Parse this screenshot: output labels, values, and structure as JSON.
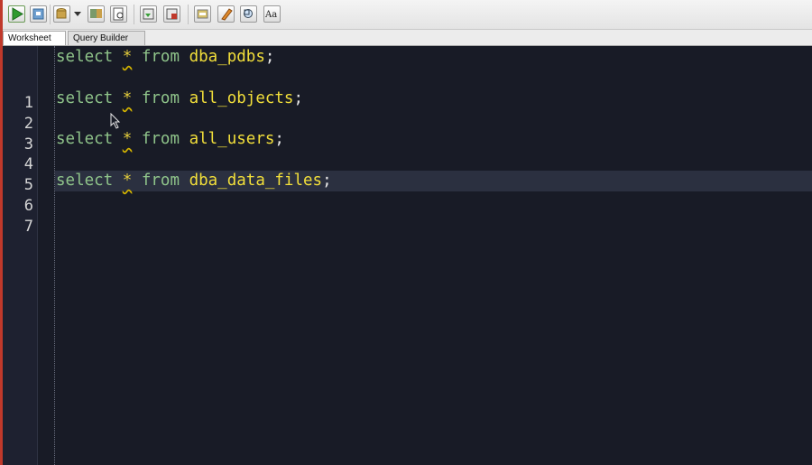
{
  "tabs": [
    {
      "label": "Worksheet",
      "active": true
    },
    {
      "label": "Query Builder",
      "active": false
    }
  ],
  "toolbar": {
    "buttons": [
      "run-statement-icon",
      "run-script-icon",
      "commit-icon",
      "dropdown-arrow-icon",
      "rollback-icon",
      "sql-history-icon",
      "explain-plan-icon",
      "autotrace-icon",
      "cancel-icon",
      "clear-icon",
      "format-icon",
      "find-icon",
      "case-icon"
    ]
  },
  "editor": {
    "current_line": 7,
    "lines": [
      {
        "num": "1",
        "keyword": "select",
        "star": "*",
        "from": "from",
        "table": "dba_pdbs",
        "end": ";"
      },
      {
        "num": "2"
      },
      {
        "num": "3",
        "keyword": "select",
        "star": "*",
        "from": "from",
        "table": "all_objects",
        "end": ";"
      },
      {
        "num": "4"
      },
      {
        "num": "5",
        "keyword": "select",
        "star": "*",
        "from": "from",
        "table": "all_users",
        "end": ";"
      },
      {
        "num": "6"
      },
      {
        "num": "7",
        "keyword": "select",
        "star": "*",
        "from": "from",
        "table": "dba_data_files",
        "end": ";"
      }
    ]
  },
  "colors": {
    "keyword": "#8fc48a",
    "identifier": "#f2df3a",
    "background": "#181b26"
  }
}
